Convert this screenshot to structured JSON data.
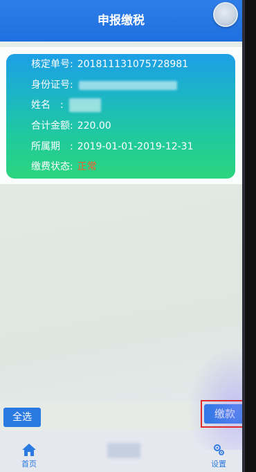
{
  "header": {
    "title": "申报缴税"
  },
  "record": {
    "fields": [
      {
        "label": "核定单号:",
        "value": "201811131075728981"
      },
      {
        "label": "身份证号:",
        "value": ""
      },
      {
        "label": "姓名　:",
        "value": ""
      },
      {
        "label": "合计金额:",
        "value": "220.00"
      },
      {
        "label": "所属期　:",
        "value": "2019-01-01-2019-12-31"
      },
      {
        "label": "缴费状态:",
        "value": "正常"
      }
    ]
  },
  "footer": {
    "select_all": "全选",
    "pay": "缴款"
  },
  "tabs": [
    {
      "label": "首页",
      "icon": "home-icon"
    },
    {
      "label": "设置",
      "icon": "gear-icon"
    }
  ],
  "colors": {
    "accent": "#2a7ae2",
    "status_normal": "#ff5a2a",
    "highlight": "#e22a2a"
  }
}
